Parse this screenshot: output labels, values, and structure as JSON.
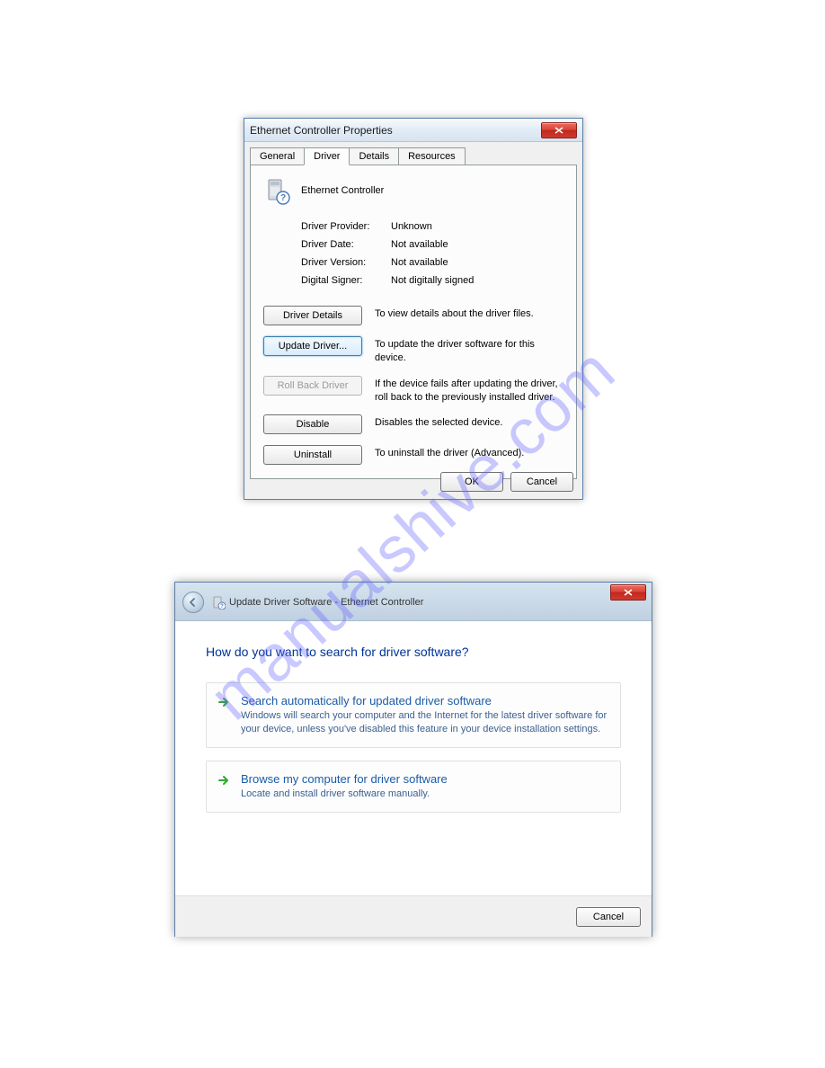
{
  "watermark": "manualshive.com",
  "dialog1": {
    "title": "Ethernet Controller Properties",
    "tabs": [
      "General",
      "Driver",
      "Details",
      "Resources"
    ],
    "device_name": "Ethernet Controller",
    "info": {
      "provider_label": "Driver Provider:",
      "provider_value": "Unknown",
      "date_label": "Driver Date:",
      "date_value": "Not available",
      "version_label": "Driver Version:",
      "version_value": "Not available",
      "signer_label": "Digital Signer:",
      "signer_value": "Not digitally signed"
    },
    "buttons": {
      "details": "Driver Details",
      "details_desc": "To view details about the driver files.",
      "update": "Update Driver...",
      "update_desc": "To update the driver software for this device.",
      "rollback": "Roll Back Driver",
      "rollback_desc": "If the device fails after updating the driver, roll back to the previously installed driver.",
      "disable": "Disable",
      "disable_desc": "Disables the selected device.",
      "uninstall": "Uninstall",
      "uninstall_desc": "To uninstall the driver (Advanced)."
    },
    "ok": "OK",
    "cancel": "Cancel"
  },
  "dialog2": {
    "breadcrumb": "Update Driver Software - Ethernet Controller",
    "heading": "How do you want to search for driver software?",
    "opt1_title": "Search automatically for updated driver software",
    "opt1_desc": "Windows will search your computer and the Internet for the latest driver software for your device, unless you've disabled this feature in your device installation settings.",
    "opt2_title": "Browse my computer for driver software",
    "opt2_desc": "Locate and install driver software manually.",
    "cancel": "Cancel"
  }
}
